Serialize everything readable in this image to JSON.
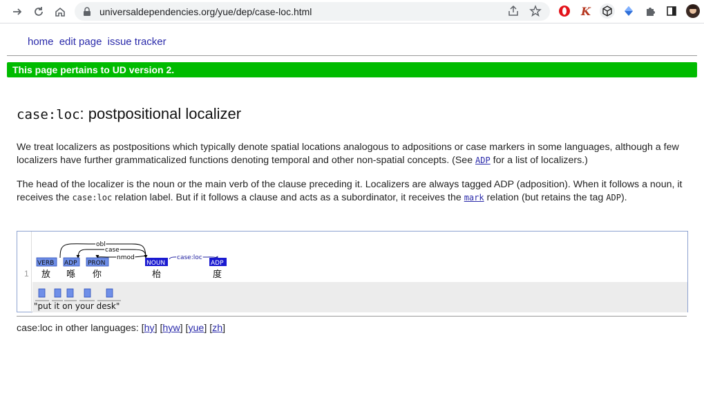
{
  "browser": {
    "url": "universaldependencies.org/yue/dep/case-loc.html"
  },
  "topnav": {
    "home": "home",
    "edit": "edit page",
    "issues": "issue tracker"
  },
  "banner": "This page pertains to UD version 2.",
  "title": {
    "code": "case:loc",
    "text": ": postpositional localizer"
  },
  "para1": {
    "text1": "We treat localizers as postpositions which typically denote spatial locations analogous to adpositions or case markers in some languages, although a few localizers have further grammaticalized functions denoting temporal and other non-spatial concepts. (See ",
    "link": "ADP",
    "text2": " for a list of localizers.)"
  },
  "para2": {
    "text1": "The head of the localizer is the noun or the main verb of the clause preceding it. Localizers are always tagged ADP (adposition). When it follows a noun, it receives the ",
    "code1": "case:loc",
    "text2": " relation label. But if it follows a clause and acts as a subordinator, it receives the ",
    "link": "mark",
    "text3": " relation (but retains the tag ",
    "code2": "ADP",
    "text4": ")."
  },
  "example": {
    "line_number": "1",
    "tokens": [
      {
        "tag": "VERB",
        "word": "放"
      },
      {
        "tag": "ADP",
        "word": "喺"
      },
      {
        "tag": "PRON",
        "word": "你"
      },
      {
        "tag": "NOUN",
        "word": "枱"
      },
      {
        "tag": "ADP",
        "word": "度"
      }
    ],
    "arcs": [
      {
        "label": "obl"
      },
      {
        "label": "case"
      },
      {
        "label": "nmod"
      },
      {
        "label": "case:loc"
      }
    ],
    "gloss": "\"put  it  on your desk\""
  },
  "other_languages": {
    "label": "case:loc in other languages: ",
    "links": [
      "hy",
      "hyw",
      "yue",
      "zh"
    ]
  }
}
